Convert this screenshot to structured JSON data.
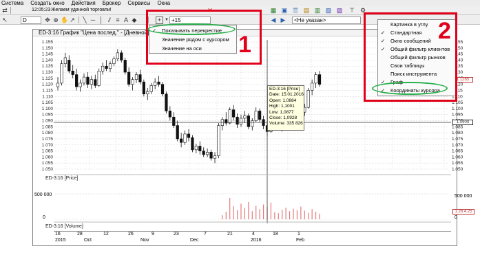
{
  "menubar": [
    "Система",
    "Создать окно",
    "Действия",
    "Брокер",
    "Сервисы",
    "Окна"
  ],
  "toolbar": {
    "time": "12:05:23",
    "message": "Желаем удачной торговли!",
    "ticker": "D",
    "crosshair_value": "+15",
    "account_placeholder": "<Не указан>"
  },
  "window": {
    "title": "ED-3:16 График \"Цена послед.\" - [Дневной]",
    "price_pane_label": "ED-3:16 [Price]",
    "volume_pane_label": "ED-3:16 [Volume]"
  },
  "colors": {
    "annotation_red": "#e0001a",
    "annotation_green": "#28b04a",
    "tooltip_bg": "#ffffe1",
    "volume_bar": "#e47a7a"
  },
  "price_axis": {
    "ticks": [
      "1.155",
      "1.150",
      "1.145",
      "1.140",
      "1.135",
      "1.130",
      "1.125",
      "1.120",
      "1.115",
      "1.110",
      "1.105",
      "1.100",
      "1.095",
      "1.090",
      "1.085",
      "1.080",
      "1.075",
      "1.070",
      "1.065",
      "1.060",
      "1.055",
      "1.050"
    ],
    "min": 1.05,
    "max": 1.155,
    "current_tag": "1.1265",
    "crosshair_tag": "1.0900"
  },
  "volume_axis": {
    "label_top": "500 000",
    "label_zero": "0",
    "tag": "1.26.4.25"
  },
  "date_axis": {
    "days": [
      "16",
      "28",
      "12",
      "26",
      "9",
      "23",
      "7",
      "21",
      "4",
      "18",
      "1"
    ],
    "months": [
      "2015",
      "Oct",
      "Nov",
      "Dec",
      "2016",
      "Feb"
    ]
  },
  "tooltip": {
    "title": "ED-3:16 [Price]",
    "date": "Date: 15.01.2016",
    "open": "Open:  1,0884",
    "high": "High:   1,1001",
    "low": "Low:    1,0877",
    "close": "Close:  1,0928",
    "volume": "Volume: 335 826"
  },
  "crosshair_menu": {
    "items": [
      {
        "label": "Показывать перекрестие",
        "checked": true
      },
      {
        "label": "Значение рядом с курсором",
        "checked": false
      },
      {
        "label": "Значение на оси",
        "checked": false
      }
    ]
  },
  "context_menu": {
    "items": [
      {
        "label": "Картинка в углу",
        "checked": false
      },
      {
        "label": "Стандартная",
        "checked": true
      },
      {
        "label": "Окно сообщений",
        "checked": true
      },
      {
        "label": "Общий фильтр клиентов",
        "checked": true
      },
      {
        "label": "Общий фильтр рынков",
        "checked": false
      },
      {
        "label": "Свои таблицы",
        "checked": false
      },
      {
        "label": "Поиск инструмента",
        "checked": false
      },
      {
        "label": "Граф",
        "checked": true
      },
      {
        "label": "Координаты курсора",
        "checked": true
      }
    ]
  },
  "annotations": {
    "label_1": "1",
    "label_2": "2"
  },
  "chart_data": {
    "type": "candlestick",
    "title": "ED-3:16 График \"Цена послед.\" - [Дневной]",
    "ylim": [
      1.05,
      1.155
    ],
    "series": [
      {
        "name": "ED-3:16 [Price]",
        "candles": [
          [
            1.118,
            1.126,
            1.115,
            1.121
          ],
          [
            1.121,
            1.14,
            1.119,
            1.137
          ],
          [
            1.137,
            1.146,
            1.134,
            1.142
          ],
          [
            1.14,
            1.144,
            1.129,
            1.131
          ],
          [
            1.131,
            1.136,
            1.125,
            1.128
          ],
          [
            1.128,
            1.133,
            1.115,
            1.118
          ],
          [
            1.118,
            1.124,
            1.114,
            1.121
          ],
          [
            1.121,
            1.129,
            1.119,
            1.126
          ],
          [
            1.126,
            1.13,
            1.117,
            1.12
          ],
          [
            1.12,
            1.127,
            1.116,
            1.124
          ],
          [
            1.124,
            1.128,
            1.117,
            1.119
          ],
          [
            1.119,
            1.133,
            1.118,
            1.131
          ],
          [
            1.131,
            1.138,
            1.128,
            1.135
          ],
          [
            1.135,
            1.14,
            1.131,
            1.133
          ],
          [
            1.133,
            1.139,
            1.13,
            1.137
          ],
          [
            1.137,
            1.143,
            1.135,
            1.141
          ],
          [
            1.141,
            1.149,
            1.139,
            1.146
          ],
          [
            1.146,
            1.148,
            1.138,
            1.14
          ],
          [
            1.14,
            1.142,
            1.128,
            1.13
          ],
          [
            1.13,
            1.134,
            1.118,
            1.12
          ],
          [
            1.12,
            1.126,
            1.115,
            1.124
          ],
          [
            1.124,
            1.13,
            1.121,
            1.128
          ],
          [
            1.128,
            1.132,
            1.12,
            1.122
          ],
          [
            1.122,
            1.124,
            1.11,
            1.112
          ],
          [
            1.112,
            1.117,
            1.107,
            1.114
          ],
          [
            1.114,
            1.121,
            1.112,
            1.119
          ],
          [
            1.119,
            1.125,
            1.116,
            1.122
          ],
          [
            1.122,
            1.127,
            1.118,
            1.12
          ],
          [
            1.12,
            1.122,
            1.11,
            1.112
          ],
          [
            1.112,
            1.114,
            1.096,
            1.098
          ],
          [
            1.098,
            1.102,
            1.09,
            1.093
          ],
          [
            1.093,
            1.097,
            1.084,
            1.086
          ],
          [
            1.086,
            1.09,
            1.073,
            1.075
          ],
          [
            1.075,
            1.08,
            1.068,
            1.072
          ],
          [
            1.072,
            1.082,
            1.07,
            1.079
          ],
          [
            1.079,
            1.083,
            1.073,
            1.076
          ],
          [
            1.076,
            1.078,
            1.064,
            1.066
          ],
          [
            1.066,
            1.071,
            1.063,
            1.069
          ],
          [
            1.069,
            1.073,
            1.062,
            1.065
          ],
          [
            1.065,
            1.068,
            1.06,
            1.062
          ],
          [
            1.062,
            1.067,
            1.06,
            1.064
          ],
          [
            1.064,
            1.066,
            1.057,
            1.059
          ],
          [
            1.059,
            1.064,
            1.055,
            1.061
          ],
          [
            1.061,
            1.088,
            1.059,
            1.086
          ],
          [
            1.086,
            1.093,
            1.082,
            1.091
          ],
          [
            1.091,
            1.097,
            1.086,
            1.088
          ],
          [
            1.088,
            1.101,
            1.087,
            1.099
          ],
          [
            1.099,
            1.103,
            1.09,
            1.093
          ],
          [
            1.093,
            1.096,
            1.084,
            1.087
          ],
          [
            1.087,
            1.095,
            1.085,
            1.092
          ],
          [
            1.092,
            1.098,
            1.088,
            1.094
          ],
          [
            1.094,
            1.096,
            1.083,
            1.085
          ],
          [
            1.085,
            1.092,
            1.082,
            1.09
          ],
          [
            1.09,
            1.101,
            1.089,
            1.098
          ],
          [
            1.098,
            1.1,
            1.089,
            1.091
          ],
          [
            1.091,
            1.094,
            1.083,
            1.086
          ],
          [
            1.086,
            1.089,
            1.077,
            1.081
          ],
          [
            1.081,
            1.091,
            1.08,
            1.088
          ],
          [
            1.088,
            1.101,
            1.087,
            1.093
          ],
          [
            1.093,
            1.096,
            1.083,
            1.085
          ],
          [
            1.085,
            1.092,
            1.081,
            1.09
          ],
          [
            1.09,
            1.093,
            1.082,
            1.084
          ],
          [
            1.084,
            1.096,
            1.083,
            1.094
          ],
          [
            1.094,
            1.098,
            1.088,
            1.091
          ],
          [
            1.091,
            1.095,
            1.084,
            1.088
          ],
          [
            1.088,
            1.099,
            1.087,
            1.097
          ],
          [
            1.097,
            1.104,
            1.094,
            1.101
          ],
          [
            1.101,
            1.117,
            1.1,
            1.115
          ],
          [
            1.115,
            1.124,
            1.111,
            1.121
          ],
          [
            1.121,
            1.13,
            1.117,
            1.128
          ],
          [
            1.128,
            1.131,
            1.118,
            1.12
          ]
        ]
      }
    ],
    "volume": [
      0,
      0,
      0,
      0,
      0,
      0,
      0,
      0,
      0,
      0,
      0,
      0,
      0,
      0,
      0,
      0,
      0,
      0,
      0,
      0,
      0,
      0,
      0,
      0,
      0,
      0,
      0,
      0,
      0,
      0,
      0,
      0,
      0,
      0,
      0,
      0,
      0,
      0,
      0,
      0,
      0,
      0,
      0,
      0,
      80000,
      150000,
      420000,
      260000,
      180000,
      310000,
      220000,
      340000,
      160000,
      270000,
      200000,
      290000,
      240000,
      330000,
      140000,
      120000,
      190000,
      230000,
      160000,
      210000,
      180000,
      250000,
      170000,
      130000,
      200000,
      150000,
      110000
    ]
  }
}
